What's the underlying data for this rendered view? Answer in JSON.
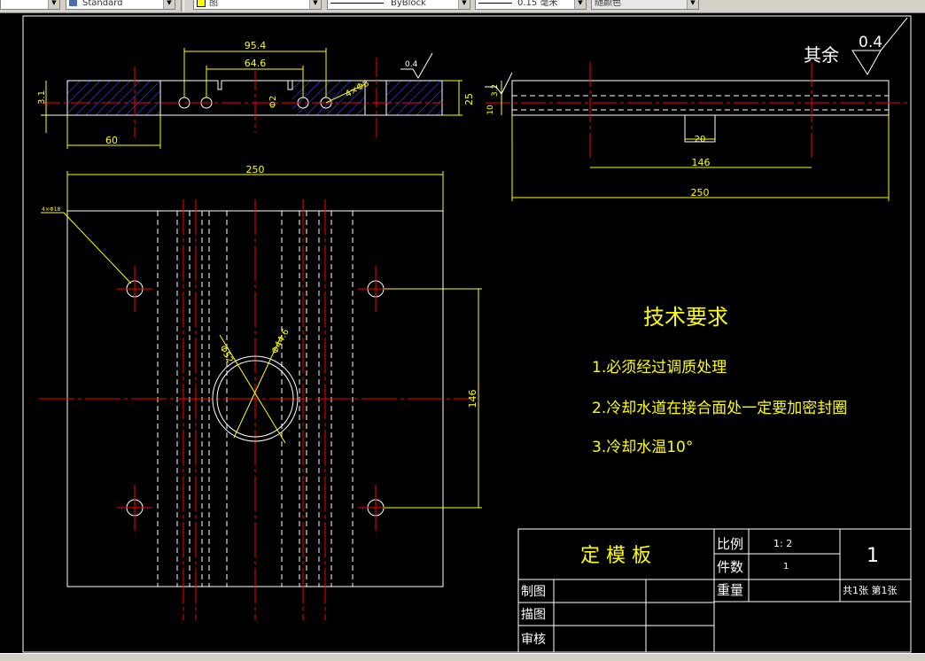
{
  "toolbar": {
    "text_style": "Standard",
    "layer": "图",
    "linetype": "ByBlock",
    "lineweight": "0.15 毫米",
    "plot_style": "随颜色",
    "layer_color": "#ffff00"
  },
  "colors": {
    "background": "#000000",
    "outline": "#ffffff",
    "dimension": "#ffff00",
    "centerline": "#ff0000",
    "hatch": "#0000cc",
    "frame": "#ffffff"
  },
  "dims": {
    "d95": "95.4",
    "d64": "64.6",
    "d04": "0.4",
    "d31": "3.1",
    "d60": "60",
    "d25": "25",
    "d4m8": "4×Φ8",
    "dphi2": "Φ2",
    "d250top": "250",
    "d146v": "146",
    "dphi52": "Φ52",
    "dphi446": "Φ44.6",
    "dhole": "4×Φ18",
    "d32": "3.2",
    "d10": "10",
    "d20": "20",
    "d146h": "146",
    "d250right": "250"
  },
  "roughness": {
    "label": "其余",
    "value": "0.4"
  },
  "tech": {
    "title": "技术要求",
    "item1": "1.必须经过调质处理",
    "item2": "2.冷却水道在接合面处一定要加密封圈",
    "item3": "3.冷却水温10°"
  },
  "title_block": {
    "part_name": "定 模 板",
    "scale_label": "比例",
    "scale_value": "1: 2",
    "qty_label": "件数",
    "qty_value": "1",
    "weight_label": "重量",
    "drawing_no": "1",
    "sheets": "共1张 第1张",
    "draw_label": "制图",
    "trace_label": "描图",
    "review_label": "审核"
  }
}
